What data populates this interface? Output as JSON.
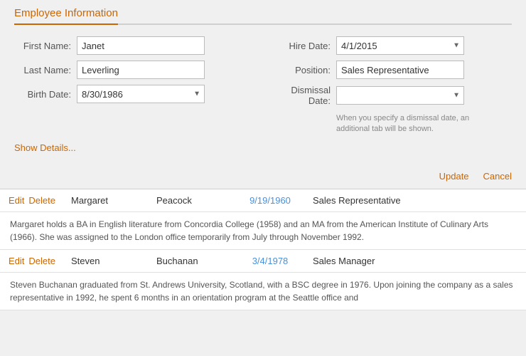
{
  "tab": {
    "label": "Employee Information"
  },
  "form": {
    "first_name_label": "First Name:",
    "last_name_label": "Last Name:",
    "birth_date_label": "Birth Date:",
    "hire_date_label": "Hire Date:",
    "position_label": "Position:",
    "dismissal_date_label": "Dismissal Date:",
    "first_name_value": "Janet",
    "last_name_value": "Leverling",
    "birth_date_value": "8/30/1986",
    "hire_date_value": "4/1/2015",
    "position_value": "Sales Representative",
    "dismissal_date_value": "",
    "dismissal_hint": "When you specify a dismissal date, an additional tab will be shown.",
    "show_details_label": "Show Details..."
  },
  "actions": {
    "update_label": "Update",
    "cancel_label": "Cancel"
  },
  "employees": [
    {
      "edit_label": "Edit",
      "delete_label": "Delete",
      "first_name": "Margaret",
      "last_name": "Peacock",
      "birth_date": "9/19/1960",
      "position": "Sales Representative",
      "bio": "Margaret holds a BA in English literature from Concordia College (1958) and an MA from the American Institute of Culinary Arts (1966). She was assigned to the London office temporarily from July through November 1992."
    },
    {
      "edit_label": "Edit",
      "delete_label": "Delete",
      "first_name": "Steven",
      "last_name": "Buchanan",
      "birth_date": "3/4/1978",
      "position": "Sales Manager",
      "bio": "Steven Buchanan graduated from St. Andrews University, Scotland, with a BSC degree in 1976. Upon joining the company as a sales representative in 1992, he spent 6 months in an orientation program at the Seattle office and"
    }
  ],
  "colors": {
    "accent": "#cc6600",
    "link_blue": "#4a90d9"
  }
}
